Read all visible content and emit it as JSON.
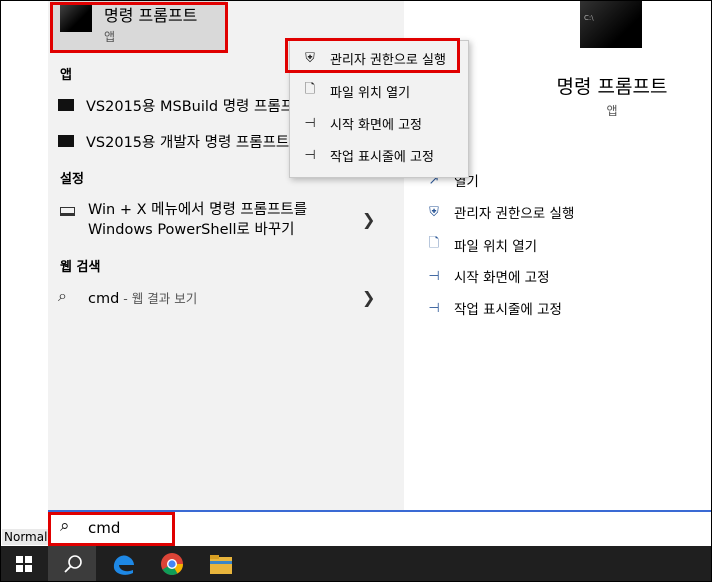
{
  "desktop": {
    "style_label": "Normal"
  },
  "best_match": {
    "title": "명령 프롬프트",
    "subtitle": "앱"
  },
  "sections": {
    "apps": "앱",
    "settings": "설정",
    "web": "웹 검색"
  },
  "apps": [
    {
      "label": "VS2015용 MSBuild 명령 프롬프트",
      "icon": "console-icon"
    },
    {
      "label": "VS2015용 개발자 명령 프롬프트",
      "icon": "console-icon"
    }
  ],
  "setting_item": {
    "line1": "Win + X 메뉴에서 명령 프롬프트를",
    "line2": "Windows PowerShell로 바꾸기"
  },
  "web_item": {
    "query": "cmd",
    "suffix": " - 웹 결과 보기"
  },
  "context_menu": [
    {
      "label": "관리자 권한으로 실행",
      "icon": "shield-icon"
    },
    {
      "label": "파일 위치 열기",
      "icon": "document-icon"
    },
    {
      "label": "시작 화면에 고정",
      "icon": "pin-icon"
    },
    {
      "label": "작업 표시줄에 고정",
      "icon": "pin-icon"
    }
  ],
  "details": {
    "title": "명령 프롬프트",
    "subtitle": "앱",
    "thumb_text": "C:\\",
    "actions": [
      {
        "label": "열기",
        "icon": "open-icon"
      },
      {
        "label": "관리자 권한으로 실행",
        "icon": "shield-icon"
      },
      {
        "label": "파일 위치 열기",
        "icon": "document-icon"
      },
      {
        "label": "시작 화면에 고정",
        "icon": "pin-icon"
      },
      {
        "label": "작업 표시줄에 고정",
        "icon": "pin-icon"
      }
    ]
  },
  "search": {
    "value": "cmd"
  },
  "taskbar": {
    "apps": [
      "edge-icon",
      "chrome-icon",
      "file-explorer-icon"
    ]
  },
  "colors": {
    "highlight": "#e00000",
    "accent": "#2b5797",
    "taskbar": "#1f1f1f"
  }
}
